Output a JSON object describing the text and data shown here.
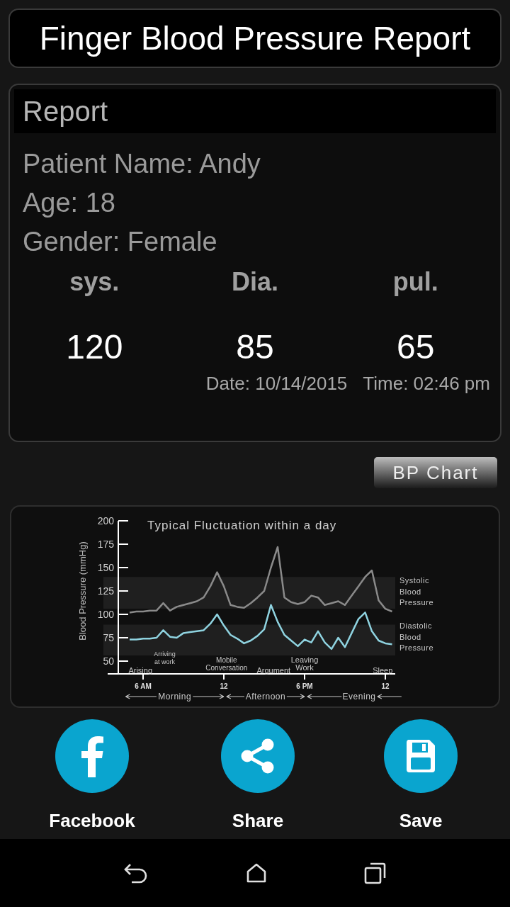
{
  "header": {
    "title": "Finger Blood Pressure Report"
  },
  "report": {
    "heading": "Report",
    "patient_name": "Patient Name: Andy",
    "age": "Age: 18",
    "gender": "Gender: Female",
    "readings": [
      {
        "label": "sys.",
        "value": "120"
      },
      {
        "label": "Dia.",
        "value": "85"
      },
      {
        "label": "pul.",
        "value": "65"
      }
    ],
    "date": "Date: 10/14/2015",
    "time": "Time: 02:46 pm"
  },
  "chart_button": "BP Chart",
  "chart": {
    "periods": [
      "Morning",
      "Afternoon",
      "Evening"
    ],
    "chart_data": {
      "type": "line",
      "title": "Typical Fluctuation within a day",
      "ylabel": "Blood Pressure (mmHg)",
      "ylim": [
        36,
        200
      ],
      "yticks": [
        50,
        75,
        100,
        125,
        150,
        175,
        200
      ],
      "bands": [
        {
          "axis": "y",
          "from": 106,
          "to": 140
        },
        {
          "axis": "y",
          "from": 56,
          "to": 89
        }
      ],
      "categories": [
        null,
        null,
        "6 AM",
        null,
        null,
        null,
        null,
        null,
        null,
        null,
        null,
        null,
        null,
        null,
        "12",
        null,
        null,
        null,
        null,
        null,
        null,
        null,
        null,
        null,
        null,
        null,
        "6 PM",
        null,
        null,
        null,
        null,
        null,
        null,
        null,
        null,
        null,
        null,
        null,
        "12",
        null
      ],
      "series": [
        {
          "name": "Systolic Blood Pressure",
          "color": "#8a8a8a",
          "values": [
            102,
            103,
            103,
            104,
            104,
            112,
            104,
            108,
            110,
            112,
            114,
            118,
            130,
            145,
            130,
            110,
            108,
            107,
            112,
            118,
            125,
            150,
            172,
            118,
            113,
            111,
            113,
            120,
            118,
            110,
            112,
            114,
            110,
            120,
            130,
            140,
            147,
            115,
            106,
            103
          ]
        },
        {
          "name": "Diastolic Blood Pressure",
          "color": "#8fd3e0",
          "values": [
            73,
            73,
            74,
            74,
            75,
            83,
            76,
            75,
            80,
            81,
            82,
            83,
            90,
            100,
            88,
            78,
            74,
            69,
            72,
            77,
            84,
            110,
            92,
            78,
            72,
            66,
            73,
            70,
            82,
            70,
            63,
            75,
            65,
            80,
            95,
            102,
            82,
            72,
            69,
            68
          ]
        }
      ],
      "annotations": [
        "Arriving at work",
        "Arising",
        "Mobile Conversation",
        "Argument",
        "Leaving Work",
        "Sleep"
      ]
    }
  },
  "share_buttons": [
    {
      "kind": "facebook",
      "label": "Facebook"
    },
    {
      "kind": "share",
      "label": "Share"
    },
    {
      "kind": "save",
      "label": "Save"
    }
  ]
}
